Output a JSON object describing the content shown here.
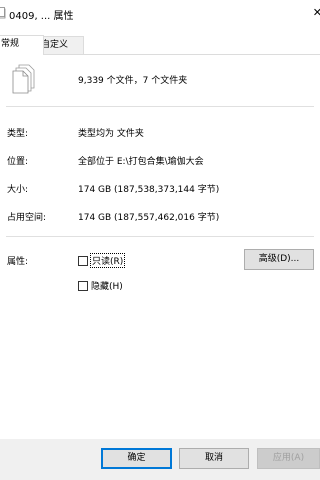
{
  "window": {
    "title": "0409, ... 属性",
    "close_glyph": "✕"
  },
  "tabs": [
    {
      "label": "常规",
      "active": true
    },
    {
      "label": "自定义",
      "active": false
    }
  ],
  "summary": {
    "text": "9,339 个文件，7 个文件夹"
  },
  "details": {
    "type_label": "类型:",
    "type_value": "类型均为 文件夹",
    "location_label": "位置:",
    "location_value": "全部位于 E:\\打包合集\\瑜伽大会",
    "size_label": "大小:",
    "size_value": "174 GB (187,538,373,144 字节)",
    "disk_label": "占用空间:",
    "disk_value": "174 GB (187,557,462,016 字节)"
  },
  "attributes": {
    "label": "属性:",
    "readonly_label": "只读(R)",
    "readonly_checked": false,
    "hidden_label": "隐藏(H)",
    "hidden_checked": false,
    "advanced_button": "高级(D)..."
  },
  "footer": {
    "ok_button": "确定",
    "cancel_button": "取消",
    "apply_button": "应用(A)",
    "apply_disabled": true
  },
  "colors": {
    "accent": "#0078d7",
    "footer_bg": "#f0f0f0",
    "disabled_text": "#a0a0a0"
  }
}
